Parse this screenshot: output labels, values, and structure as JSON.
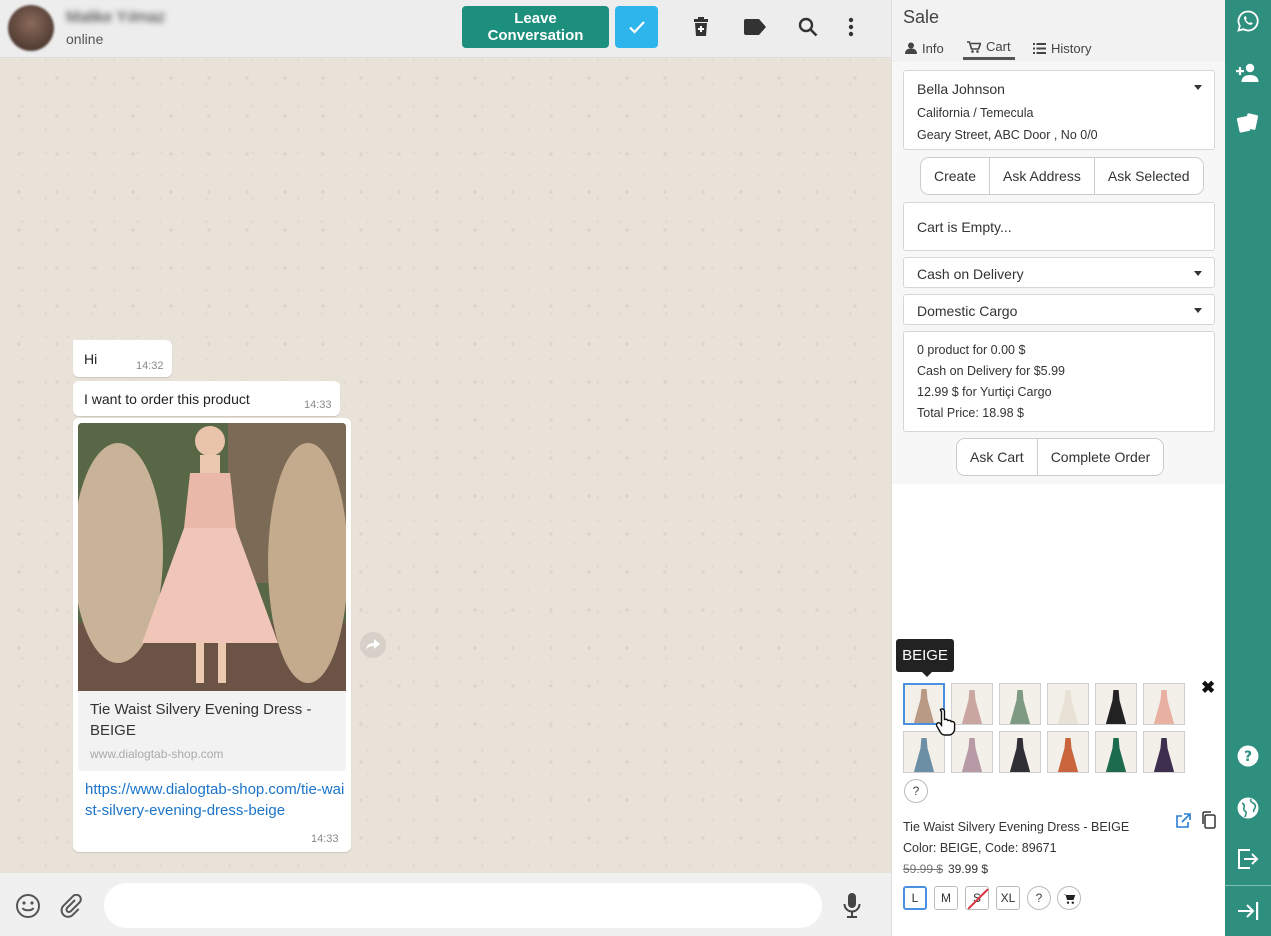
{
  "chat": {
    "contact_name": "Malike Yılmaz",
    "contact_status": "online",
    "leave_label": "Leave Conversation",
    "messages": [
      {
        "text": "Hi",
        "time": "14:32"
      },
      {
        "text": "I want to order this product",
        "time": "14:33"
      }
    ],
    "product_message": {
      "title": "Tie Waist Silvery Evening Dress - BEIGE",
      "domain": "www.dialogtab-shop.com",
      "link": "https://www.dialogtab-shop.com/tie-waist-silvery-evening-dress-beige",
      "time": "14:33"
    },
    "input_placeholder": ""
  },
  "sale": {
    "title": "Sale",
    "tabs": [
      {
        "label": "Info",
        "icon": "user-icon"
      },
      {
        "label": "Cart",
        "icon": "cart-icon",
        "active": true
      },
      {
        "label": "History",
        "icon": "list-icon"
      }
    ],
    "customer": {
      "name": "Bella Johnson",
      "location": "California / Temecula",
      "address": "Geary Street, ABC Door , No 0/0"
    },
    "address_buttons": [
      "Create",
      "Ask Address",
      "Ask Selected"
    ],
    "cart_status": "Cart is Empty...",
    "payment_method": "Cash on Delivery",
    "shipping_method": "Domestic Cargo",
    "summary": [
      "0 product for 0.00 $",
      "Cash on Delivery for $5.99",
      "12.99 $ for Yurtiçi Cargo",
      "Total Price: 18.98 $"
    ],
    "cart_buttons": [
      "Ask Cart",
      "Complete Order"
    ],
    "variant_tooltip": "BEIGE",
    "variants": [
      {
        "color": "#b99a85"
      },
      {
        "color": "#c9a7a0"
      },
      {
        "color": "#7e9a83"
      },
      {
        "color": "#e7e1d6"
      },
      {
        "color": "#222222"
      },
      {
        "color": "#e8b0a0"
      },
      {
        "color": "#6d8fa6"
      },
      {
        "color": "#b89aa6"
      },
      {
        "color": "#2f2f35"
      },
      {
        "color": "#c9643c"
      },
      {
        "color": "#1c6b4e"
      },
      {
        "color": "#3e2f4f"
      }
    ],
    "unknown_variant_label": "?",
    "product": {
      "name": "Tie Waist Silvery Evening Dress - BEIGE",
      "details": "Color: BEIGE, Code: 89671",
      "old_price": "59.99 $",
      "price": "39.99 $",
      "sizes": [
        "L",
        "M",
        "S",
        "XL"
      ],
      "size_help": "?"
    }
  },
  "colors": {
    "accent_green": "#1d8f7d",
    "rail_green": "#2e8f7f",
    "check_blue": "#2eb6ec",
    "link_blue": "#1b74c9"
  }
}
